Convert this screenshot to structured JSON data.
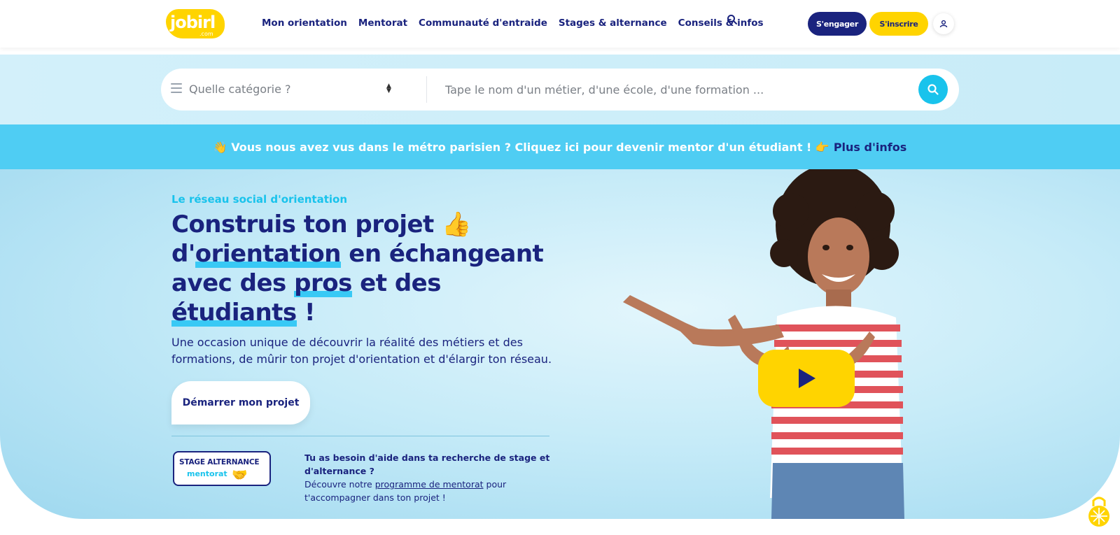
{
  "header": {
    "logo_text": "jobirl",
    "logo_suffix": ".com",
    "nav": [
      "Mon orientation",
      "Mentorat",
      "Communauté d'entraide",
      "Stages & alternance",
      "Conseils & infos"
    ],
    "search_icon": "search-icon",
    "engage_label": "S'engager",
    "signup_label": "S'inscrire",
    "user_icon": "user-icon"
  },
  "search": {
    "category_placeholder": "Quelle catégorie ?",
    "query_placeholder": "Tape le nom d'un métier, d'une école, d'une formation ..."
  },
  "announcement": {
    "text": "👋 Vous nous avez vus dans le métro parisien ? Cliquez ici pour devenir mentor d'un étudiant ! 👉",
    "link": "Plus d'infos"
  },
  "hero": {
    "eyebrow": "Le réseau social d'orientation",
    "title_1": "Construis ton projet 👍",
    "title_2a": "d'",
    "title_2b": "orientation",
    "title_2c": " en échangeant",
    "title_3a": "avec des ",
    "title_3b": "pros",
    "title_3c": " et des",
    "title_4a": "étudiants",
    "title_4b": " !",
    "lead": "Une occasion unique de découvrir la réalité des métiers et des formations, de mûrir ton projet d'orientation et d'élargir ton réseau.",
    "cta": "Démarrer mon projet",
    "badge_line1": "STAGE ALTERNANCE",
    "badge_line2": "mentorat",
    "badge_emoji": "🤝",
    "help_title": "Tu as besoin d'aide dans ta recherche de stage et d'alternance  ?",
    "help_pre": "Découvre notre ",
    "help_link": "programme de mentorat",
    "help_post": " pour t'accompagner dans ton projet !"
  },
  "colors": {
    "navy": "#1a237e",
    "yellow": "#ffd400",
    "cyan": "#19c3ec",
    "banner": "#4fcdf3"
  }
}
